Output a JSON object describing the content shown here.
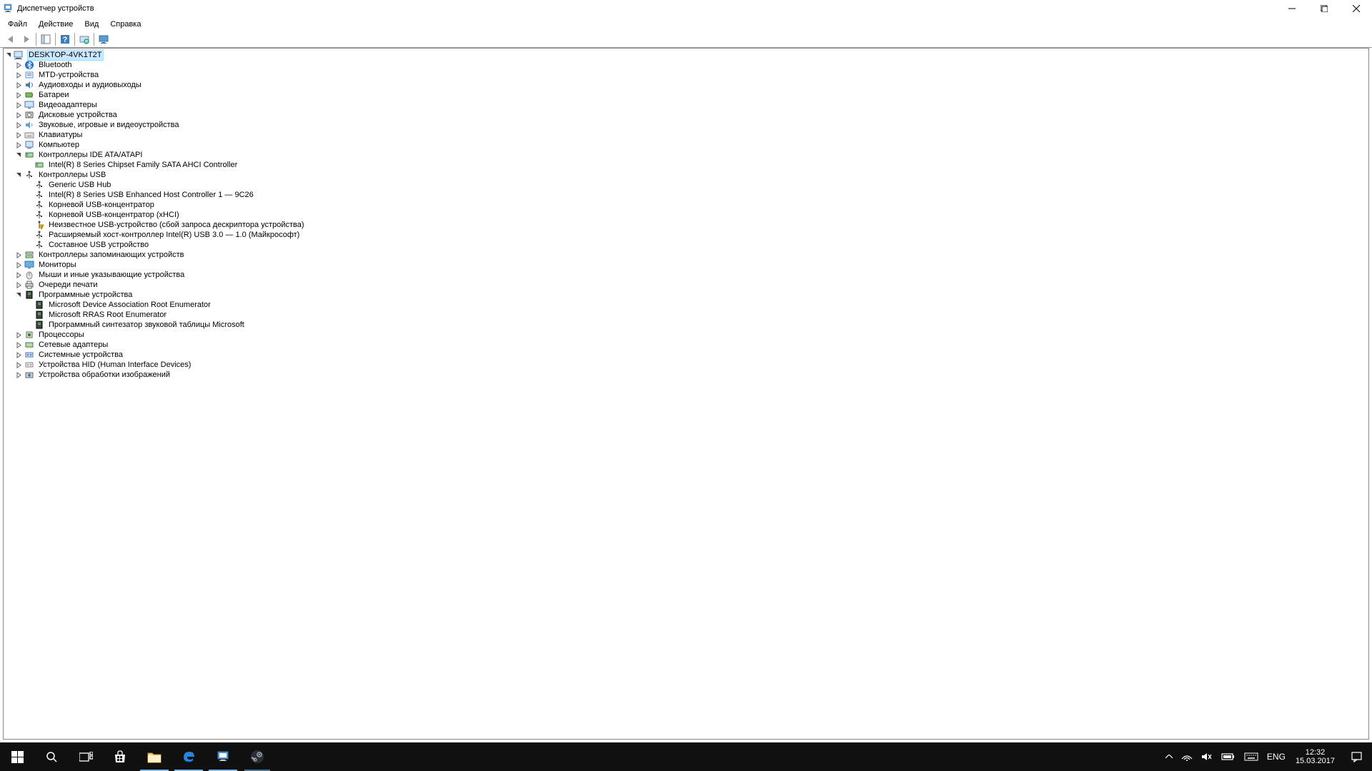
{
  "window": {
    "title": "Диспетчер устройств"
  },
  "menu": {
    "file": "Файл",
    "action": "Действие",
    "view": "Вид",
    "help": "Справка"
  },
  "tree": {
    "root": "DESKTOP-4VK1T2T",
    "cat": {
      "bluetooth": "Bluetooth",
      "mtd": "MTD-устройства",
      "audio": "Аудиовходы и аудиовыходы",
      "batteries": "Батареи",
      "display": "Видеоадаптеры",
      "disk": "Дисковые устройства",
      "sound": "Звуковые, игровые и видеоустройства",
      "keyboards": "Клавиатуры",
      "computer": "Компьютер",
      "ide": "Контроллеры IDE ATA/ATAPI",
      "usb": "Контроллеры USB",
      "storage": "Контроллеры запоминающих устройств",
      "monitors": "Мониторы",
      "mice": "Мыши и иные указывающие устройства",
      "printq": "Очереди печати",
      "software": "Программные устройства",
      "cpu": "Процессоры",
      "network": "Сетевые адаптеры",
      "system": "Системные устройства",
      "hid": "Устройства HID (Human Interface Devices)",
      "imaging": "Устройства обработки изображений"
    },
    "ide_children": {
      "i0": "Intel(R) 8 Series Chipset Family SATA AHCI Controller"
    },
    "usb_children": {
      "u0": "Generic USB Hub",
      "u1": "Intel(R) 8 Series USB Enhanced Host Controller 1  — 9C26",
      "u2": "Корневой USB-концентратор",
      "u3": "Корневой USB-концентратор (xHCI)",
      "u4": "Неизвестное USB-устройство (сбой запроса дескриптора устройства)",
      "u5": "Расширяемый хост-контроллер Intel(R) USB 3.0 — 1.0 (Майкрософт)",
      "u6": "Составное USB устройство"
    },
    "software_children": {
      "s0": "Microsoft Device Association Root Enumerator",
      "s1": "Microsoft RRAS Root Enumerator",
      "s2": "Программный синтезатор звуковой таблицы Microsoft"
    }
  },
  "systray": {
    "lang": "ENG",
    "time": "12:32",
    "date": "15.03.2017"
  }
}
